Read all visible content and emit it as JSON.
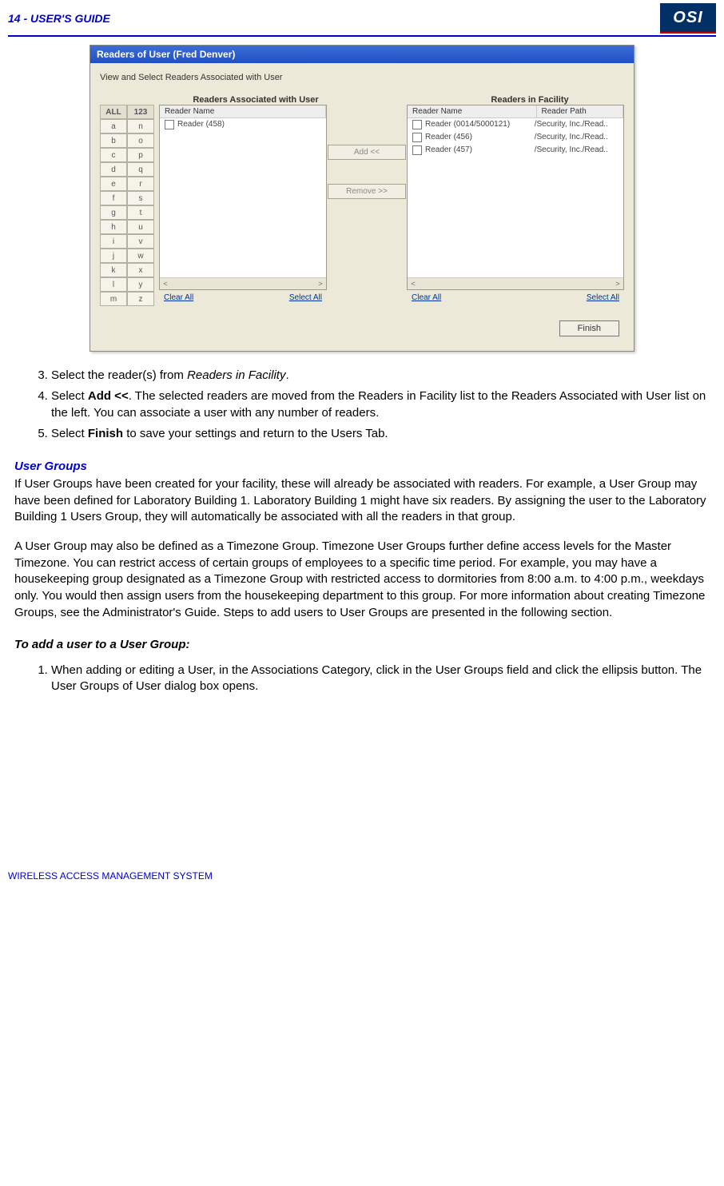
{
  "header": {
    "left_prefix": "14 - ",
    "left_title": "USER'S GUIDE",
    "logo_text": "OSI"
  },
  "dialog": {
    "title": "Readers of User (Fred Denver)",
    "subtitle": "View and Select Readers Associated with User",
    "left_header": "Readers Associated with User",
    "right_header": "Readers in Facility",
    "alpha_head_left": "ALL",
    "alpha_head_right": "123",
    "alpha_pairs": [
      [
        "a",
        "n"
      ],
      [
        "b",
        "o"
      ],
      [
        "c",
        "p"
      ],
      [
        "d",
        "q"
      ],
      [
        "e",
        "r"
      ],
      [
        "f",
        "s"
      ],
      [
        "g",
        "t"
      ],
      [
        "h",
        "u"
      ],
      [
        "i",
        "v"
      ],
      [
        "j",
        "w"
      ],
      [
        "k",
        "x"
      ],
      [
        "l",
        "y"
      ],
      [
        "m",
        "z"
      ]
    ],
    "left_list": {
      "columns": [
        "Reader Name"
      ],
      "items": [
        "Reader (458)"
      ]
    },
    "right_list": {
      "columns": [
        "Reader Name",
        "Reader Path"
      ],
      "items": [
        {
          "name": "Reader (0014/5000121)",
          "path": "/Security, Inc./Read.."
        },
        {
          "name": "Reader (456)",
          "path": "/Security, Inc./Read.."
        },
        {
          "name": "Reader (457)",
          "path": "/Security, Inc./Read.."
        }
      ]
    },
    "add_button": "Add    <<",
    "remove_button": "Remove >>",
    "clear_all": "Clear All",
    "select_all": "Select All",
    "finish": "Finish",
    "scroll_left": "<",
    "scroll_right": ">"
  },
  "list_a": {
    "start": 3,
    "items": [
      {
        "pre": "Select the reader(s) from ",
        "ital": "Readers in Facility",
        "post": "."
      },
      {
        "pre": "Select ",
        "bold": "Add <<",
        "post2": ".   The selected readers are moved from the Readers in Facility list to the Readers Associated with User list on the left.   You can associate a user with any number of readers."
      },
      {
        "pre": "Select ",
        "bold": "Finish",
        "post2": " to save your settings and return to the Users Tab."
      }
    ]
  },
  "section_user_groups": {
    "heading": "User Groups",
    "p1": "If User Groups have been created for your facility, these will already be associated with readers.  For example, a User Group may have been defined for Laboratory Building 1.   Laboratory Building 1 might have six readers.   By assigning the user to the Laboratory Building 1 Users Group, they will automatically be associated with all the readers in that group.",
    "p2": "A User Group may also be defined as a Timezone Group.   Timezone User Groups further define access levels for the Master Timezone.   You can restrict access of certain groups of employees to a specific time period.   For example, you may have a housekeeping group designated as a Timezone Group with restricted access to dormitories from 8:00 a.m. to 4:00 p.m., weekdays only.   You would then assign users from the housekeeping department to this group.   For more information about creating Timezone Groups, see the Administrator's Guide.   Steps to add users to User Groups are presented in the following section."
  },
  "section_add_user": {
    "heading": "To add a user to a User Group:",
    "step1": "When adding or editing a User, in the Associations Category, click in the User Groups field and click the ellipsis button.   The User Groups of User dialog box opens."
  },
  "footer": "WIRELESS ACCESS MANAGEMENT SYSTEM"
}
